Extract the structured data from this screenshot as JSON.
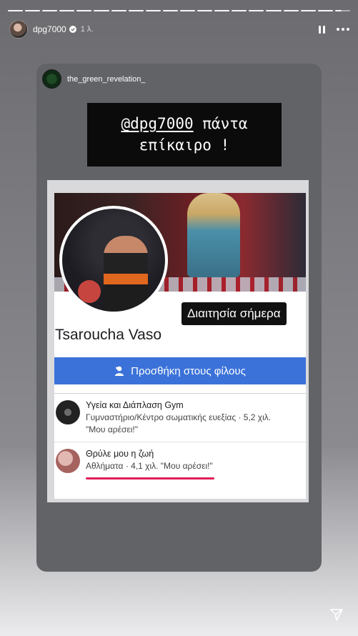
{
  "story": {
    "segments": 20,
    "username": "dpg7000",
    "time": "1 λ."
  },
  "card": {
    "username": "the_green_revelation_",
    "banner_mention": "@dpg7000",
    "banner_line1_rest": " πάντα",
    "banner_line2": "επίκαιρο !"
  },
  "fb": {
    "sticker": "Διαιτησία σήμερα",
    "name": "Tsaroucha Vaso",
    "add_friend": "Προσθήκη στους φίλους",
    "pages": [
      {
        "title": "Υγεία και Διάπλαση Gym",
        "line2": "Γυμναστήριο/Κέντρο σωματικής ευεξίας · 5,2 χιλ.",
        "line3": "\"Μου αρέσει!\""
      },
      {
        "title": "Θρύλε μου η ζωή",
        "line2": "Αθλήματα · 4,1 χιλ. \"Μου αρέσει!\""
      }
    ]
  },
  "colors": {
    "fb_blue": "#3b72d9",
    "underline": "#e01e5a"
  },
  "icons": [
    "verified-icon",
    "pause-icon",
    "more-icon",
    "add-friend-icon",
    "send-icon"
  ]
}
